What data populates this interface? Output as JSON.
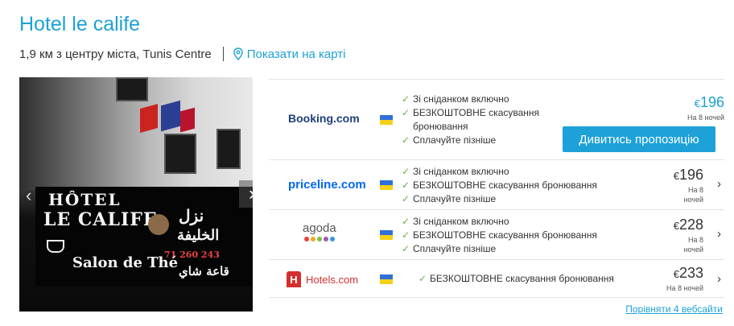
{
  "hotel": {
    "title": "Hotel le calife",
    "distance": "1,9 км з центру міста, Tunis Centre",
    "map_link": "Показати на карті"
  },
  "photo": {
    "sign_line1": "HÔTEL",
    "sign_line2": "LE CALIFE",
    "sign_arabic1": "نزل",
    "sign_arabic2": "الخليفة",
    "sign_phone": "71 260 243",
    "sign_line3": "Salon de Thé",
    "sign_arabic3": "قاعة شاي"
  },
  "offers": [
    {
      "provider": "Booking.com",
      "logo_color": "#1d3f7a",
      "features": [
        "Зі сніданком включно",
        "БЕЗКОШТОВНЕ скасування",
        "бронювання",
        "Сплачуйте пізніше"
      ],
      "currency": "€",
      "price": "196",
      "note": "На 8 ночей",
      "cta": "Дивитись пропозицію"
    },
    {
      "provider": "priceline.com",
      "logo_color": "#0068ef",
      "features": [
        "Зі сніданком включно",
        "БЕЗКОШТОВНЕ скасування бронювання",
        "Сплачуйте пізніше"
      ],
      "currency": "€",
      "price": "196",
      "note1": "На 8",
      "note2": "ночей"
    },
    {
      "provider": "agoda",
      "logo_color": "#555555",
      "features": [
        "Зі сніданком включно",
        "БЕЗКОШТОВНЕ скасування бронювання",
        "Сплачуйте пізніше"
      ],
      "currency": "€",
      "price": "228",
      "note1": "На 8",
      "note2": "ночей"
    },
    {
      "provider": "Hotels.com",
      "logo_color": "#d32f2f",
      "features": [
        "БЕЗКОШТОВНЕ скасування бронювання"
      ],
      "currency": "€",
      "price": "233",
      "note": "На 8 ночей"
    }
  ],
  "compare_link": "Порівняти 4 вебсайти",
  "colors": {
    "accent": "#1da1d8",
    "check": "#6ab04c"
  }
}
